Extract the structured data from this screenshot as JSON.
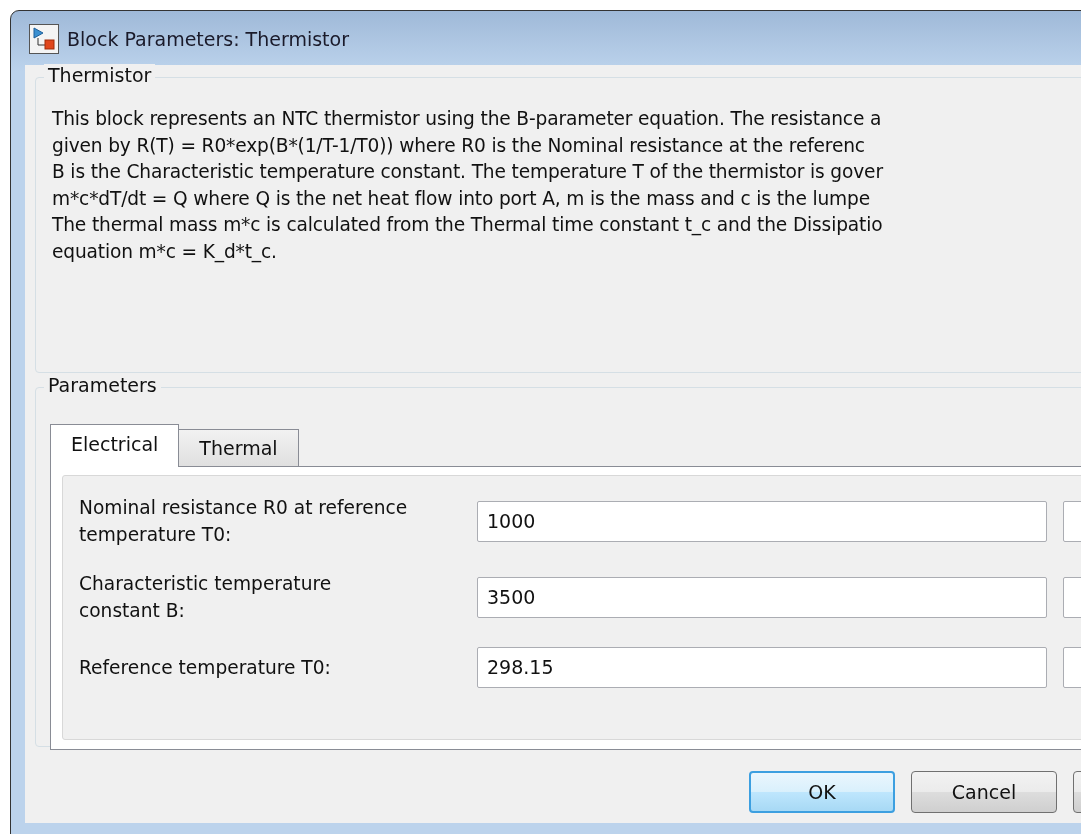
{
  "window": {
    "title": "Block Parameters: Thermistor"
  },
  "description_group": {
    "title": "Thermistor",
    "lines": [
      "This block represents an NTC thermistor using the B-parameter equation. The resistance a",
      "given by R(T) = R0*exp(B*(1/T-1/T0)) where R0 is the Nominal resistance at the referenc",
      "B is the Characteristic temperature constant. The temperature T of the thermistor is gover",
      "m*c*dT/dt = Q where Q is the net heat flow into port A, m is the mass and c is the lumpe",
      "The thermal mass m*c is calculated from the Thermal time constant t_c and the Dissipatio",
      "equation m*c = K_d*t_c."
    ]
  },
  "parameters_group": {
    "title": "Parameters",
    "tabs": [
      {
        "label": "Electrical",
        "selected": true
      },
      {
        "label": "Thermal",
        "selected": false
      }
    ],
    "fields": [
      {
        "label": "Nominal resistance R0 at reference temperature T0:",
        "value": "1000"
      },
      {
        "label": "Characteristic temperature constant B:",
        "value": "3500"
      },
      {
        "label": "Reference temperature T0:",
        "value": "298.15"
      }
    ]
  },
  "buttons": [
    {
      "label": "OK",
      "default": true
    },
    {
      "label": "Cancel",
      "default": false
    }
  ]
}
